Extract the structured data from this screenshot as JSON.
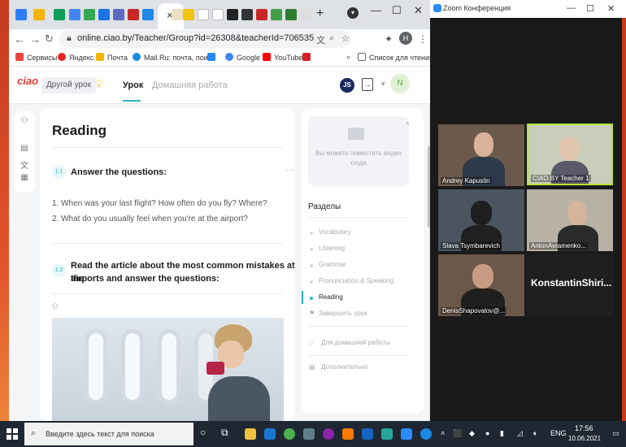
{
  "browser": {
    "url": "online.ciao.by/Teacher/Group?id=26308&teacherId=706535",
    "profile_initial": "H",
    "tab_close": "×",
    "new_tab": "+",
    "bookmarks": [
      {
        "label": "Сервисы",
        "color": "#e8453c"
      },
      {
        "label": "Яндекс",
        "color": "#e52620"
      },
      {
        "label": "Почта",
        "color": "#f7b500"
      },
      {
        "label": "Mail.Ru: почта, пои...",
        "color": "#168de2"
      },
      {
        "label": "",
        "color": "#2787f5"
      },
      {
        "label": "Google",
        "color": "#4285f4"
      },
      {
        "label": "YouTube",
        "color": "#ff0000"
      },
      {
        "label": "",
        "color": "#d32027"
      }
    ],
    "reading_list": "Список для чтения",
    "more": "»"
  },
  "app": {
    "logo": "ciao",
    "other_lesson": "Другой урок",
    "tabs": [
      "Урок",
      "Домашняя работа"
    ],
    "user_initials": "JS",
    "avatar_initial": "N"
  },
  "lesson": {
    "title": "Reading",
    "q1": {
      "number": "1.1",
      "title": "Answer the questions:",
      "lines": [
        "1. When was your last flight? How often do you fly? Where?",
        "2. What do you usually feel when you're at the airport?"
      ]
    },
    "q2": {
      "number": "1.2",
      "title_line1": "Read the article about the most common mistakes at the",
      "title_line2": "airports and answer the questions:"
    },
    "more": "···"
  },
  "sidebar": {
    "video_placeholder": "Вы можете поместить видео сюда",
    "sections_title": "Разделы",
    "sections": [
      {
        "label": "Vocabulary",
        "active": false
      },
      {
        "label": "Listening",
        "active": false
      },
      {
        "label": "Grammar",
        "active": false
      },
      {
        "label": "Pronunciation & Speaking",
        "active": false
      },
      {
        "label": "Reading",
        "active": true
      }
    ],
    "finish": "Завершить урок",
    "homework": "Для домашней работы",
    "extra": "Дополнительно"
  },
  "zoom": {
    "title": "Zoom Конференция",
    "participants": [
      {
        "name": "Andrey Kapustin"
      },
      {
        "name": "CIAO.BY Teacher 1",
        "speaker": true
      },
      {
        "name": "Slava Tsymbarevich"
      },
      {
        "name": "AntonAvramenko..."
      },
      {
        "name": "DenisShapovalov@..."
      },
      {
        "name": "KonstantinShiri..."
      }
    ]
  },
  "taskbar": {
    "search_placeholder": "Введите здесь текст для поиска",
    "lang": "ENG",
    "time": "17:56",
    "date": "10.06.2021"
  }
}
